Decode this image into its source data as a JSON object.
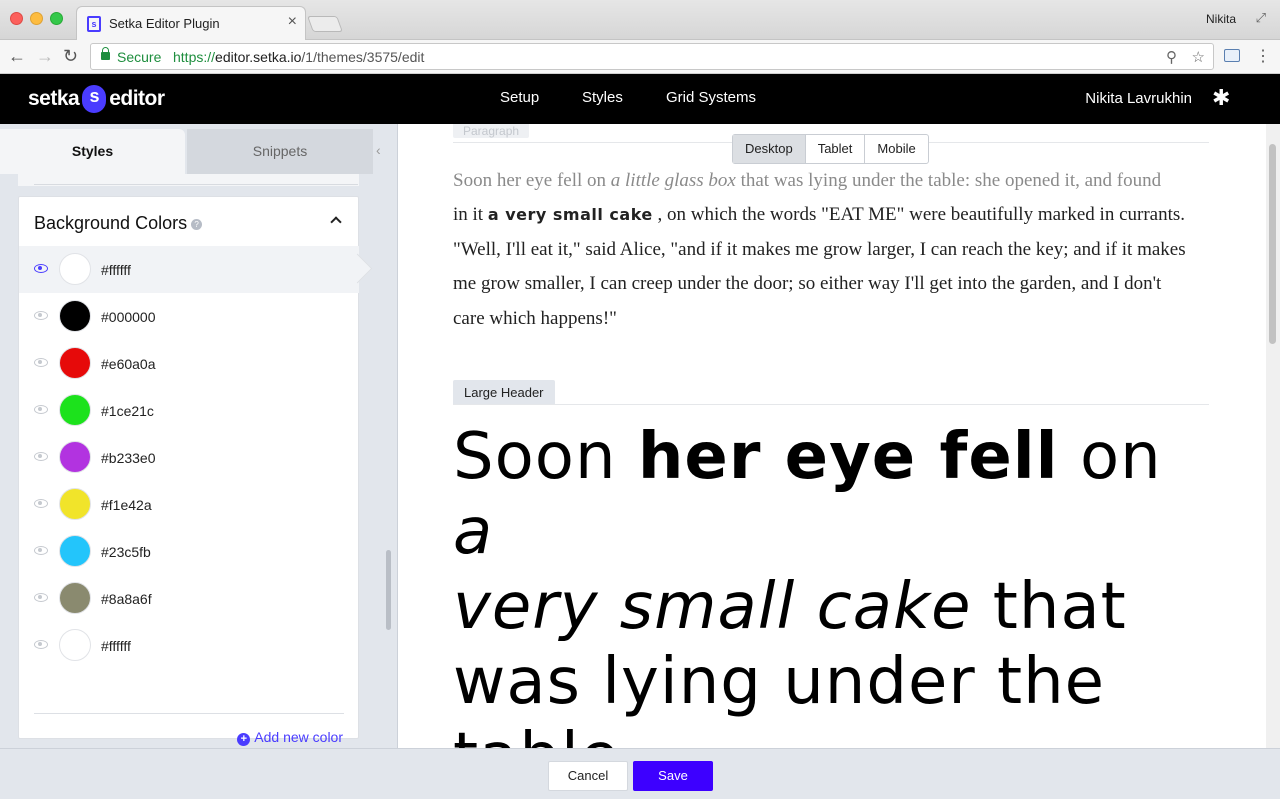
{
  "browser": {
    "tab_title": "Setka Editor Plugin",
    "tab_close": "×",
    "profile_name": "Nikita",
    "resize": "⤢",
    "nav": {
      "back": "←",
      "forward": "→",
      "reload": "↻"
    },
    "secure_label": "Secure",
    "url": {
      "scheme": "https://",
      "host": "editor.setka.io",
      "path": "/1/themes/3575/edit"
    },
    "key_icon": "⚲",
    "star_icon": "☆",
    "menu_icon": "⋮"
  },
  "header": {
    "logo_left": "setka",
    "logo_right": "editor",
    "nav": [
      "Setup",
      "Styles",
      "Grid Systems"
    ],
    "user_name": "Nikita Lavrukhin",
    "settings_icon": "✱"
  },
  "sidebar": {
    "tabs": {
      "styles": "Styles",
      "snippets": "Snippets"
    },
    "collapse_icon": "‹",
    "section_title": "Background Colors",
    "help_icon": "?",
    "colors": [
      {
        "hex": "#ffffff",
        "label": "#ffffff"
      },
      {
        "hex": "#000000",
        "label": "#000000"
      },
      {
        "hex": "#e60a0a",
        "label": "#e60a0a"
      },
      {
        "hex": "#1ce21c",
        "label": "#1ce21c"
      },
      {
        "hex": "#b233e0",
        "label": "#b233e0"
      },
      {
        "hex": "#f1e42a",
        "label": "#f1e42a"
      },
      {
        "hex": "#23c5fb",
        "label": "#23c5fb"
      },
      {
        "hex": "#8a8a6f",
        "label": "#8a8a6f"
      },
      {
        "hex": "#ffffff",
        "label": "#ffffff"
      }
    ],
    "add_color": "Add new color",
    "add_icon": "+"
  },
  "content": {
    "paragraph_tag": "Paragraph",
    "devices": [
      "Desktop",
      "Tablet",
      "Mobile"
    ],
    "paragraph": {
      "p1": "Soon her eye fell on ",
      "p1_ital": "a little glass box",
      "p1_tail": " that was lying under the table: she opened it, and found",
      "p2": "in it ",
      "p2_bold": "a very small cake",
      "p2_tail": " , on which the words \"EAT ME\" were beautifully marked in currants.",
      "p3": "\"Well, I'll eat it,\" said Alice, \"and if it makes me grow larger, I can reach the key; and if it makes",
      "p4": "me grow smaller, I can creep under the door; so either way I'll get into the garden, and I don't",
      "p5": "care which happens!\""
    },
    "large_header_tag": "Large Header",
    "large_header": {
      "t1": "Soon ",
      "t2_bold": "her eye fell",
      "t3": " on ",
      "t4_ital_a": "a",
      "t4_ital_b": "very small cake",
      "t5": " that",
      "t6": "was lying under the",
      "t7": "table"
    }
  },
  "footer": {
    "cancel": "Cancel",
    "save": "Save"
  },
  "colors": {
    "accent": "#3d00ff",
    "header_bg": "#000000",
    "sidebar_bg": "#e2e6ec"
  }
}
